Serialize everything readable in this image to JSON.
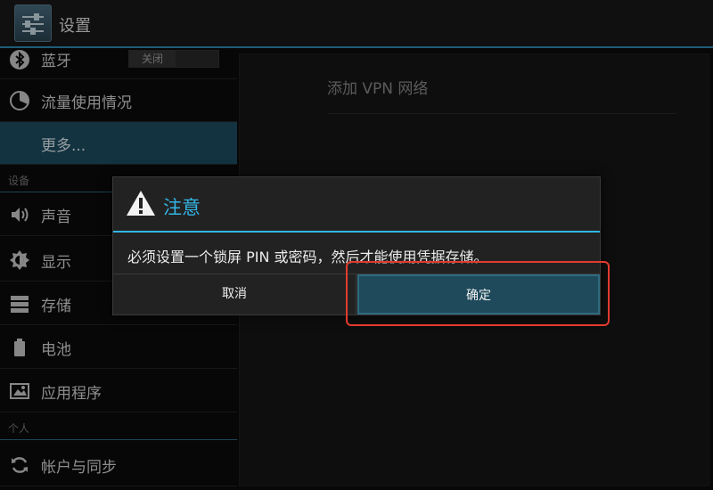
{
  "action_bar": {
    "title": "设置",
    "icon": "settings-sliders-icon"
  },
  "sidebar": {
    "items": [
      {
        "label": "蓝牙",
        "icon": "bluetooth-icon",
        "toggle_off_label": "关闭"
      },
      {
        "label": "流量使用情况",
        "icon": "data-usage-icon"
      },
      {
        "label": "更多...",
        "selected": true
      },
      {
        "section": "设备"
      },
      {
        "label": "声音",
        "icon": "volume-icon"
      },
      {
        "label": "显示",
        "icon": "brightness-icon"
      },
      {
        "label": "存储",
        "icon": "storage-icon"
      },
      {
        "label": "电池",
        "icon": "battery-icon"
      },
      {
        "label": "应用程序",
        "icon": "apps-icon"
      },
      {
        "section": "个人"
      },
      {
        "label": "帐户与同步",
        "icon": "sync-icon"
      }
    ]
  },
  "main": {
    "title": "添加 VPN 网络"
  },
  "dialog": {
    "title": "注意",
    "icon": "warning-icon",
    "message": "必须设置一个锁屏 PIN 或密码，然后才能使用凭据存储。",
    "cancel_label": "取消",
    "ok_label": "确定"
  },
  "colors": {
    "accent": "#33b5e5",
    "selected_bg": "#1f4f64",
    "highlight": "#e23b2e"
  }
}
